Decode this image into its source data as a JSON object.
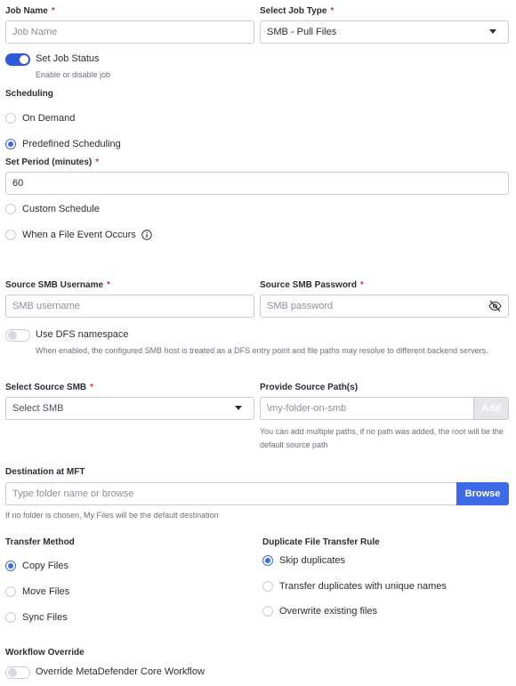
{
  "job_name": {
    "label": "Job Name",
    "required": "*",
    "placeholder": "Job Name"
  },
  "job_type": {
    "label": "Select Job Type",
    "required": "*",
    "value": "SMB - Pull Files"
  },
  "job_status": {
    "label": "Set Job Status",
    "help": "Enable or disable job",
    "enabled": true
  },
  "scheduling": {
    "label": "Scheduling",
    "options": [
      "On Demand",
      "Predefined Scheduling",
      "Custom Schedule",
      "When a File Event Occurs"
    ],
    "selected": "Predefined Scheduling"
  },
  "period": {
    "label": "Set Period (minutes)",
    "required": "*",
    "value": "60"
  },
  "smb_username": {
    "label": "Source SMB Username",
    "required": "*",
    "placeholder": "SMB username"
  },
  "smb_password": {
    "label": "Source SMB Password",
    "required": "*",
    "placeholder": "SMB password"
  },
  "dfs": {
    "label": "Use DFS namespace",
    "help": "When enabled, the configured SMB host is treated as a DFS entry point and file paths may resolve to different backend servers.",
    "enabled": false
  },
  "source_smb": {
    "label": "Select Source SMB",
    "required": "*",
    "placeholder": "Select SMB"
  },
  "source_paths": {
    "label": "Provide Source Path(s)",
    "placeholder": "\\my-folder-on-smb",
    "add_label": "Add",
    "help": "You can add multiple paths, if no path was added, the root will be the default source path"
  },
  "destination": {
    "label": "Destination at MFT",
    "placeholder": "Type folder name or browse",
    "browse_label": "Browse",
    "help": "If no folder is chosen, My Files will be the default destination"
  },
  "transfer_method": {
    "label": "Transfer Method",
    "options": [
      "Copy Files",
      "Move Files",
      "Sync Files"
    ],
    "selected": "Copy Files"
  },
  "duplicate_rule": {
    "label": "Duplicate File Transfer Rule",
    "options": [
      "Skip duplicates",
      "Transfer duplicates with unique names",
      "Overwrite existing files"
    ],
    "selected": "Skip duplicates"
  },
  "workflow_override": {
    "label": "Workflow Override",
    "toggle_label": "Override MetaDefender Core Workflow",
    "enabled": false
  },
  "colors": {
    "accent": "#2f5ad8",
    "required": "#d83b3b",
    "border": "#c9ccd3"
  },
  "icons": {
    "job_type_caret": "chevron-down-icon",
    "password_toggle": "eye-off-icon",
    "file_event_info": "info-icon"
  }
}
